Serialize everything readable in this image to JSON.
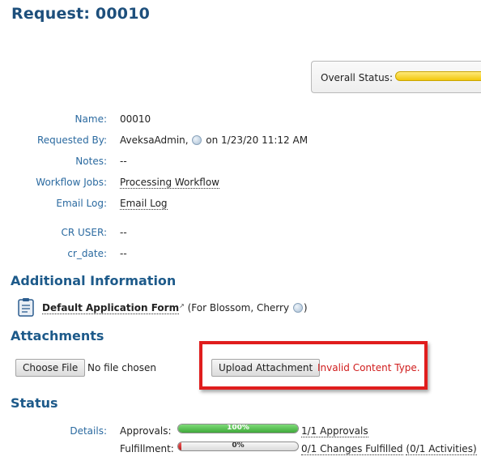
{
  "page": {
    "title": "Request: 00010"
  },
  "overall_status": {
    "label": "Overall Status:"
  },
  "details": {
    "name_label": "Name:",
    "name_value": "00010",
    "requested_by_label": "Requested By:",
    "requested_by_user": "AveksaAdmin,",
    "requested_by_date": "on 1/23/20 11:12 AM",
    "notes_label": "Notes:",
    "notes_value": "--",
    "workflow_jobs_label": "Workflow Jobs:",
    "workflow_jobs_value": "Processing Workflow",
    "email_log_label": "Email Log:",
    "email_log_value": "Email Log",
    "cr_user_label": "CR USER:",
    "cr_user_value": "--",
    "cr_date_label": "cr_date:",
    "cr_date_value": "--"
  },
  "additional_info": {
    "heading": "Additional Information",
    "form_link": "Default Application Form",
    "form_context": "(For Blossom, Cherry"
  },
  "attachments": {
    "heading": "Attachments",
    "choose_file_label": "Choose File",
    "no_file_text": "No file chosen",
    "upload_label": "Upload Attachment",
    "error_text": "Invalid Content Type."
  },
  "status": {
    "heading": "Status",
    "details_label": "Details:",
    "approvals_label": "Approvals:",
    "approvals_percent_text": "100%",
    "approvals_progress": 1.0,
    "approvals_link": "1/1 Approvals",
    "fulfillment_label": "Fulfillment:",
    "fulfillment_percent_text": "0%",
    "fulfillment_progress": 0.0,
    "fulfillment_link": "0/1 Changes Fulfilled",
    "fulfillment_activities": "(0/1 Activities)"
  },
  "colors": {
    "heading": "#1d5a8a",
    "label": "#2b6aa0",
    "error": "#d01c1c",
    "highlight": "#e01d1d"
  }
}
